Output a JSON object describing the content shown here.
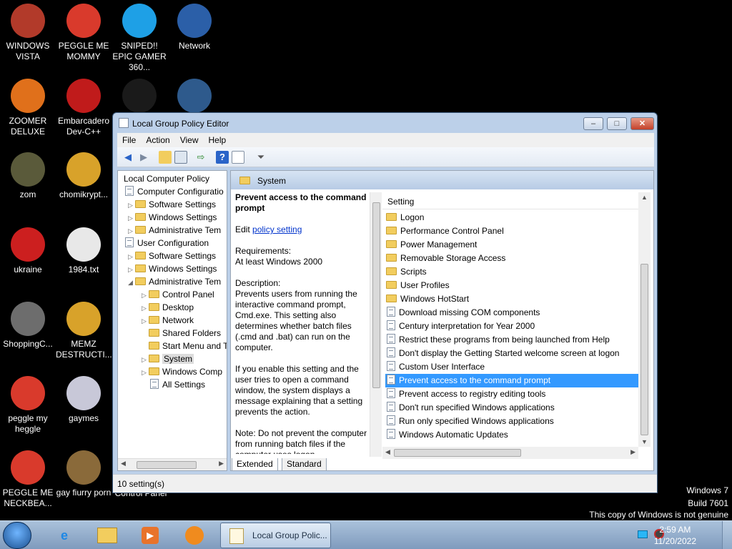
{
  "desktop": {
    "icons": [
      {
        "label": "WINDOWS VISTA",
        "icon": "vista-disc-icon",
        "color": "#b23a2a"
      },
      {
        "label": "PEGGLE ME MOMMY",
        "icon": "peggle-icon",
        "color": "#d93a2c"
      },
      {
        "label": "SNIPED!! EPIC GAMER 360...",
        "icon": "skype-icon",
        "color": "#1ea0e6"
      },
      {
        "label": "Network",
        "icon": "network-globe-icon",
        "color": "#2b5fa8"
      },
      {
        "label": "ZOOMER DELUXE",
        "icon": "zoomer-icon",
        "color": "#e0701b"
      },
      {
        "label": "Embarcadero Dev-C++",
        "icon": "devcpp-icon",
        "color": "#c01b1b"
      },
      {
        "label": "",
        "icon": "dark-logo-icon",
        "color": "#1a1a1a"
      },
      {
        "label": "",
        "icon": "screen-icon",
        "color": "#2e5a8c"
      },
      {
        "label": "zom",
        "icon": "flower-icon",
        "color": "#5a5a3a"
      },
      {
        "label": "chomikrypt...",
        "icon": "clock-file-icon",
        "color": "#d8a22a"
      },
      {
        "label": "ukraine",
        "icon": "radiation-icon",
        "color": "#cc1f1f"
      },
      {
        "label": "1984.txt",
        "icon": "text-file-icon",
        "color": "#e8e8e8"
      },
      {
        "label": "ShoppingC...",
        "icon": "flash-icon",
        "color": "#6d6d6d"
      },
      {
        "label": "MEMZ DESTRUCTI...",
        "icon": "clock-file-icon",
        "color": "#d8a22a"
      },
      {
        "label": "peggle my heggle",
        "icon": "peggle-icon",
        "color": "#d93a2c"
      },
      {
        "label": "gaymes",
        "icon": "media-icon",
        "color": "#c8c8d8"
      },
      {
        "label": "PEGGLE ME NECKBEA...",
        "icon": "peggle-icon",
        "color": "#d93a2c"
      },
      {
        "label": "gay fiurry porn",
        "icon": "dog-box-icon",
        "color": "#8a6a3a"
      }
    ],
    "behind_label": "Control Panel",
    "watermark": {
      "line1": "Windows 7",
      "line2": "Build 7601",
      "line3": "This copy of Windows is not genuine"
    }
  },
  "window": {
    "title": "Local Group Policy Editor",
    "controls": {
      "minimize": "–",
      "maximize": "□",
      "close": "✕"
    },
    "menu": [
      "File",
      "Action",
      "View",
      "Help"
    ],
    "tree": [
      {
        "label": "Local Computer Policy",
        "depth": 0,
        "arrow": "",
        "icon": "policy"
      },
      {
        "label": "Computer Configuratio",
        "depth": 0,
        "arrow": "",
        "icon": "computer"
      },
      {
        "label": "Software Settings",
        "depth": 1,
        "arrow": "▷",
        "icon": "folder"
      },
      {
        "label": "Windows Settings",
        "depth": 1,
        "arrow": "▷",
        "icon": "folder"
      },
      {
        "label": "Administrative Tem",
        "depth": 1,
        "arrow": "▷",
        "icon": "folder"
      },
      {
        "label": "User Configuration",
        "depth": 0,
        "arrow": "",
        "icon": "user"
      },
      {
        "label": "Software Settings",
        "depth": 1,
        "arrow": "▷",
        "icon": "folder"
      },
      {
        "label": "Windows Settings",
        "depth": 1,
        "arrow": "▷",
        "icon": "folder"
      },
      {
        "label": "Administrative Tem",
        "depth": 1,
        "arrow": "◢",
        "icon": "folder"
      },
      {
        "label": "Control Panel",
        "depth": 2,
        "arrow": "▷",
        "icon": "folder"
      },
      {
        "label": "Desktop",
        "depth": 2,
        "arrow": "▷",
        "icon": "folder"
      },
      {
        "label": "Network",
        "depth": 2,
        "arrow": "▷",
        "icon": "folder"
      },
      {
        "label": "Shared Folders",
        "depth": 2,
        "arrow": "",
        "icon": "folder"
      },
      {
        "label": "Start Menu and T",
        "depth": 2,
        "arrow": "",
        "icon": "folder"
      },
      {
        "label": "System",
        "depth": 2,
        "arrow": "▷",
        "icon": "folder",
        "selected": true
      },
      {
        "label": "Windows Comp",
        "depth": 2,
        "arrow": "▷",
        "icon": "folder"
      },
      {
        "label": "All Settings",
        "depth": 2,
        "arrow": "",
        "icon": "settings"
      }
    ],
    "pane_header": "System",
    "description": {
      "title": "Prevent access to the command prompt",
      "edit_prefix": "Edit",
      "edit_link": "policy setting",
      "requirements_label": "Requirements:",
      "requirements_value": "At least Windows 2000",
      "description_label": "Description:",
      "description_text": "Prevents users from running the interactive command prompt, Cmd.exe. This setting also determines whether batch files (.cmd and .bat) can run on the computer.",
      "enable_text": "If you enable this setting and the user tries to open a command window, the system displays a message explaining that a setting prevents the action.",
      "note_text": "Note: Do not prevent the computer from running batch files if the computer uses logon"
    },
    "list": {
      "column_header": "Setting",
      "rows": [
        {
          "label": "Logon",
          "type": "folder"
        },
        {
          "label": "Performance Control Panel",
          "type": "folder"
        },
        {
          "label": "Power Management",
          "type": "folder"
        },
        {
          "label": "Removable Storage Access",
          "type": "folder"
        },
        {
          "label": "Scripts",
          "type": "folder"
        },
        {
          "label": "User Profiles",
          "type": "folder"
        },
        {
          "label": "Windows HotStart",
          "type": "folder"
        },
        {
          "label": "Download missing COM components",
          "type": "setting"
        },
        {
          "label": "Century interpretation for Year 2000",
          "type": "setting"
        },
        {
          "label": "Restrict these programs from being launched from Help",
          "type": "setting"
        },
        {
          "label": "Don't display the Getting Started welcome screen at logon",
          "type": "setting"
        },
        {
          "label": "Custom User Interface",
          "type": "setting"
        },
        {
          "label": "Prevent access to the command prompt",
          "type": "setting",
          "selected": true
        },
        {
          "label": "Prevent access to registry editing tools",
          "type": "setting"
        },
        {
          "label": "Don't run specified Windows applications",
          "type": "setting"
        },
        {
          "label": "Run only specified Windows applications",
          "type": "setting"
        },
        {
          "label": "Windows Automatic Updates",
          "type": "setting"
        }
      ]
    },
    "tabs": [
      "Extended",
      "Standard"
    ],
    "status": "10 setting(s)"
  },
  "taskbar": {
    "active_app": "Local Group Polic...",
    "time": "2:59 AM",
    "date": "11/20/2022"
  },
  "colors": {
    "selection": "#3399ff",
    "link": "#0033cc"
  }
}
